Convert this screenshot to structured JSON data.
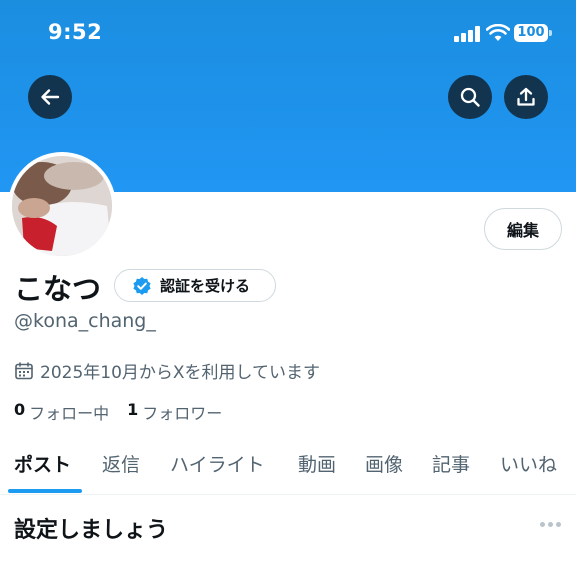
{
  "status_bar": {
    "time": "9:52",
    "battery": "100"
  },
  "profile": {
    "display_name": "こなつ",
    "handle": "@kona_chang_",
    "joined": "2025年10月からXを利用しています",
    "following_count": "0",
    "following_label": "フォロー中",
    "followers_count": "1",
    "followers_label": "フォロワー"
  },
  "buttons": {
    "edit": "編集",
    "verify": "認証を受ける"
  },
  "tabs": [
    {
      "label": "ポスト",
      "active": true
    },
    {
      "label": "返信"
    },
    {
      "label": "ハイライト"
    },
    {
      "label": "動画"
    },
    {
      "label": "画像"
    },
    {
      "label": "記事"
    },
    {
      "label": "いいね"
    }
  ],
  "section": {
    "title": "設定しましょう"
  },
  "colors": {
    "accent": "#1d9bf0",
    "banner": "#2196f3",
    "verified_badge": "#1d9bf0"
  },
  "icons": [
    "back-arrow-icon",
    "search-icon",
    "share-icon",
    "verified-badge-icon",
    "calendar-icon",
    "more-icon"
  ]
}
